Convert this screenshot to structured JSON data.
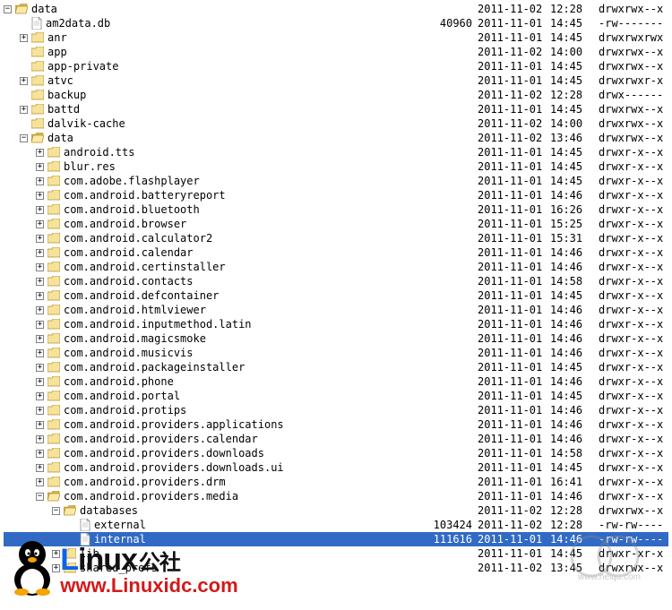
{
  "expand": {
    "plus": "+",
    "minus": "−"
  },
  "watermark": {
    "brand_head": "L",
    "brand_rest": "inux",
    "brand_suffix": "公社",
    "url": "www.Linuxidc.com",
    "wm2": "www.heiqu.com"
  },
  "rows": [
    {
      "indent": 0,
      "exp": "minus",
      "type": "folder-open",
      "name": "data",
      "size": "",
      "date": "2011-11-02",
      "time": "12:28",
      "perm": "drwxrwx--x",
      "sel": false
    },
    {
      "indent": 1,
      "exp": "none",
      "type": "file",
      "name": "am2data.db",
      "size": "40960",
      "date": "2011-11-01",
      "time": "14:45",
      "perm": "-rw-------",
      "sel": false
    },
    {
      "indent": 1,
      "exp": "plus",
      "type": "folder",
      "name": "anr",
      "size": "",
      "date": "2011-11-01",
      "time": "14:45",
      "perm": "drwxrwxrwx",
      "sel": false
    },
    {
      "indent": 1,
      "exp": "none",
      "type": "folder",
      "name": "app",
      "size": "",
      "date": "2011-11-02",
      "time": "14:00",
      "perm": "drwxrwx--x",
      "sel": false
    },
    {
      "indent": 1,
      "exp": "none",
      "type": "folder",
      "name": "app-private",
      "size": "",
      "date": "2011-11-01",
      "time": "14:45",
      "perm": "drwxrwx--x",
      "sel": false
    },
    {
      "indent": 1,
      "exp": "plus",
      "type": "folder",
      "name": "atvc",
      "size": "",
      "date": "2011-11-01",
      "time": "14:45",
      "perm": "drwxrwxr-x",
      "sel": false
    },
    {
      "indent": 1,
      "exp": "none",
      "type": "folder",
      "name": "backup",
      "size": "",
      "date": "2011-11-02",
      "time": "12:28",
      "perm": "drwx------",
      "sel": false
    },
    {
      "indent": 1,
      "exp": "plus",
      "type": "folder",
      "name": "battd",
      "size": "",
      "date": "2011-11-01",
      "time": "14:45",
      "perm": "drwxrwx--x",
      "sel": false
    },
    {
      "indent": 1,
      "exp": "none",
      "type": "folder",
      "name": "dalvik-cache",
      "size": "",
      "date": "2011-11-02",
      "time": "14:00",
      "perm": "drwxrwx--x",
      "sel": false
    },
    {
      "indent": 1,
      "exp": "minus",
      "type": "folder-open",
      "name": "data",
      "size": "",
      "date": "2011-11-02",
      "time": "13:46",
      "perm": "drwxrwx--x",
      "sel": false
    },
    {
      "indent": 2,
      "exp": "plus",
      "type": "folder",
      "name": "android.tts",
      "size": "",
      "date": "2011-11-01",
      "time": "14:45",
      "perm": "drwxr-x--x",
      "sel": false
    },
    {
      "indent": 2,
      "exp": "plus",
      "type": "folder",
      "name": "blur.res",
      "size": "",
      "date": "2011-11-01",
      "time": "14:45",
      "perm": "drwxr-x--x",
      "sel": false
    },
    {
      "indent": 2,
      "exp": "plus",
      "type": "folder",
      "name": "com.adobe.flashplayer",
      "size": "",
      "date": "2011-11-01",
      "time": "14:45",
      "perm": "drwxr-x--x",
      "sel": false
    },
    {
      "indent": 2,
      "exp": "plus",
      "type": "folder",
      "name": "com.android.batteryreport",
      "size": "",
      "date": "2011-11-01",
      "time": "14:46",
      "perm": "drwxr-x--x",
      "sel": false
    },
    {
      "indent": 2,
      "exp": "plus",
      "type": "folder",
      "name": "com.android.bluetooth",
      "size": "",
      "date": "2011-11-01",
      "time": "16:26",
      "perm": "drwxr-x--x",
      "sel": false
    },
    {
      "indent": 2,
      "exp": "plus",
      "type": "folder",
      "name": "com.android.browser",
      "size": "",
      "date": "2011-11-01",
      "time": "15:25",
      "perm": "drwxr-x--x",
      "sel": false
    },
    {
      "indent": 2,
      "exp": "plus",
      "type": "folder",
      "name": "com.android.calculator2",
      "size": "",
      "date": "2011-11-01",
      "time": "15:31",
      "perm": "drwxr-x--x",
      "sel": false
    },
    {
      "indent": 2,
      "exp": "plus",
      "type": "folder",
      "name": "com.android.calendar",
      "size": "",
      "date": "2011-11-01",
      "time": "14:46",
      "perm": "drwxr-x--x",
      "sel": false
    },
    {
      "indent": 2,
      "exp": "plus",
      "type": "folder",
      "name": "com.android.certinstaller",
      "size": "",
      "date": "2011-11-01",
      "time": "14:46",
      "perm": "drwxr-x--x",
      "sel": false
    },
    {
      "indent": 2,
      "exp": "plus",
      "type": "folder",
      "name": "com.android.contacts",
      "size": "",
      "date": "2011-11-01",
      "time": "14:58",
      "perm": "drwxr-x--x",
      "sel": false
    },
    {
      "indent": 2,
      "exp": "plus",
      "type": "folder",
      "name": "com.android.defcontainer",
      "size": "",
      "date": "2011-11-01",
      "time": "14:45",
      "perm": "drwxr-x--x",
      "sel": false
    },
    {
      "indent": 2,
      "exp": "plus",
      "type": "folder",
      "name": "com.android.htmlviewer",
      "size": "",
      "date": "2011-11-01",
      "time": "14:46",
      "perm": "drwxr-x--x",
      "sel": false
    },
    {
      "indent": 2,
      "exp": "plus",
      "type": "folder",
      "name": "com.android.inputmethod.latin",
      "size": "",
      "date": "2011-11-01",
      "time": "14:46",
      "perm": "drwxr-x--x",
      "sel": false
    },
    {
      "indent": 2,
      "exp": "plus",
      "type": "folder",
      "name": "com.android.magicsmoke",
      "size": "",
      "date": "2011-11-01",
      "time": "14:46",
      "perm": "drwxr-x--x",
      "sel": false
    },
    {
      "indent": 2,
      "exp": "plus",
      "type": "folder",
      "name": "com.android.musicvis",
      "size": "",
      "date": "2011-11-01",
      "time": "14:46",
      "perm": "drwxr-x--x",
      "sel": false
    },
    {
      "indent": 2,
      "exp": "plus",
      "type": "folder",
      "name": "com.android.packageinstaller",
      "size": "",
      "date": "2011-11-01",
      "time": "14:45",
      "perm": "drwxr-x--x",
      "sel": false
    },
    {
      "indent": 2,
      "exp": "plus",
      "type": "folder",
      "name": "com.android.phone",
      "size": "",
      "date": "2011-11-01",
      "time": "14:46",
      "perm": "drwxr-x--x",
      "sel": false
    },
    {
      "indent": 2,
      "exp": "plus",
      "type": "folder",
      "name": "com.android.portal",
      "size": "",
      "date": "2011-11-01",
      "time": "14:45",
      "perm": "drwxr-x--x",
      "sel": false
    },
    {
      "indent": 2,
      "exp": "plus",
      "type": "folder",
      "name": "com.android.protips",
      "size": "",
      "date": "2011-11-01",
      "time": "14:46",
      "perm": "drwxr-x--x",
      "sel": false
    },
    {
      "indent": 2,
      "exp": "plus",
      "type": "folder",
      "name": "com.android.providers.applications",
      "size": "",
      "date": "2011-11-01",
      "time": "14:46",
      "perm": "drwxr-x--x",
      "sel": false
    },
    {
      "indent": 2,
      "exp": "plus",
      "type": "folder",
      "name": "com.android.providers.calendar",
      "size": "",
      "date": "2011-11-01",
      "time": "14:46",
      "perm": "drwxr-x--x",
      "sel": false
    },
    {
      "indent": 2,
      "exp": "plus",
      "type": "folder",
      "name": "com.android.providers.downloads",
      "size": "",
      "date": "2011-11-01",
      "time": "14:58",
      "perm": "drwxr-x--x",
      "sel": false
    },
    {
      "indent": 2,
      "exp": "plus",
      "type": "folder",
      "name": "com.android.providers.downloads.ui",
      "size": "",
      "date": "2011-11-01",
      "time": "14:45",
      "perm": "drwxr-x--x",
      "sel": false
    },
    {
      "indent": 2,
      "exp": "plus",
      "type": "folder",
      "name": "com.android.providers.drm",
      "size": "",
      "date": "2011-11-01",
      "time": "16:41",
      "perm": "drwxr-x--x",
      "sel": false
    },
    {
      "indent": 2,
      "exp": "minus",
      "type": "folder-open",
      "name": "com.android.providers.media",
      "size": "",
      "date": "2011-11-01",
      "time": "14:46",
      "perm": "drwxr-x--x",
      "sel": false
    },
    {
      "indent": 3,
      "exp": "minus",
      "type": "folder-open",
      "name": "databases",
      "size": "",
      "date": "2011-11-02",
      "time": "12:28",
      "perm": "drwxrwx--x",
      "sel": false
    },
    {
      "indent": 4,
      "exp": "none",
      "type": "file",
      "name": "external",
      "size": "103424",
      "date": "2011-11-02",
      "time": "12:28",
      "perm": "-rw-rw----",
      "sel": false
    },
    {
      "indent": 4,
      "exp": "none",
      "type": "file",
      "name": "internal",
      "size": "111616",
      "date": "2011-11-01",
      "time": "14:46",
      "perm": "-rw-rw----",
      "sel": true
    },
    {
      "indent": 3,
      "exp": "plus",
      "type": "folder",
      "name": "lib",
      "size": "",
      "date": "2011-11-01",
      "time": "14:45",
      "perm": "drwxr-xr-x",
      "sel": false
    },
    {
      "indent": 3,
      "exp": "plus",
      "type": "folder",
      "name": "shared_prefs",
      "size": "",
      "date": "2011-11-02",
      "time": "13:45",
      "perm": "drwxrwx--x",
      "sel": false
    }
  ]
}
